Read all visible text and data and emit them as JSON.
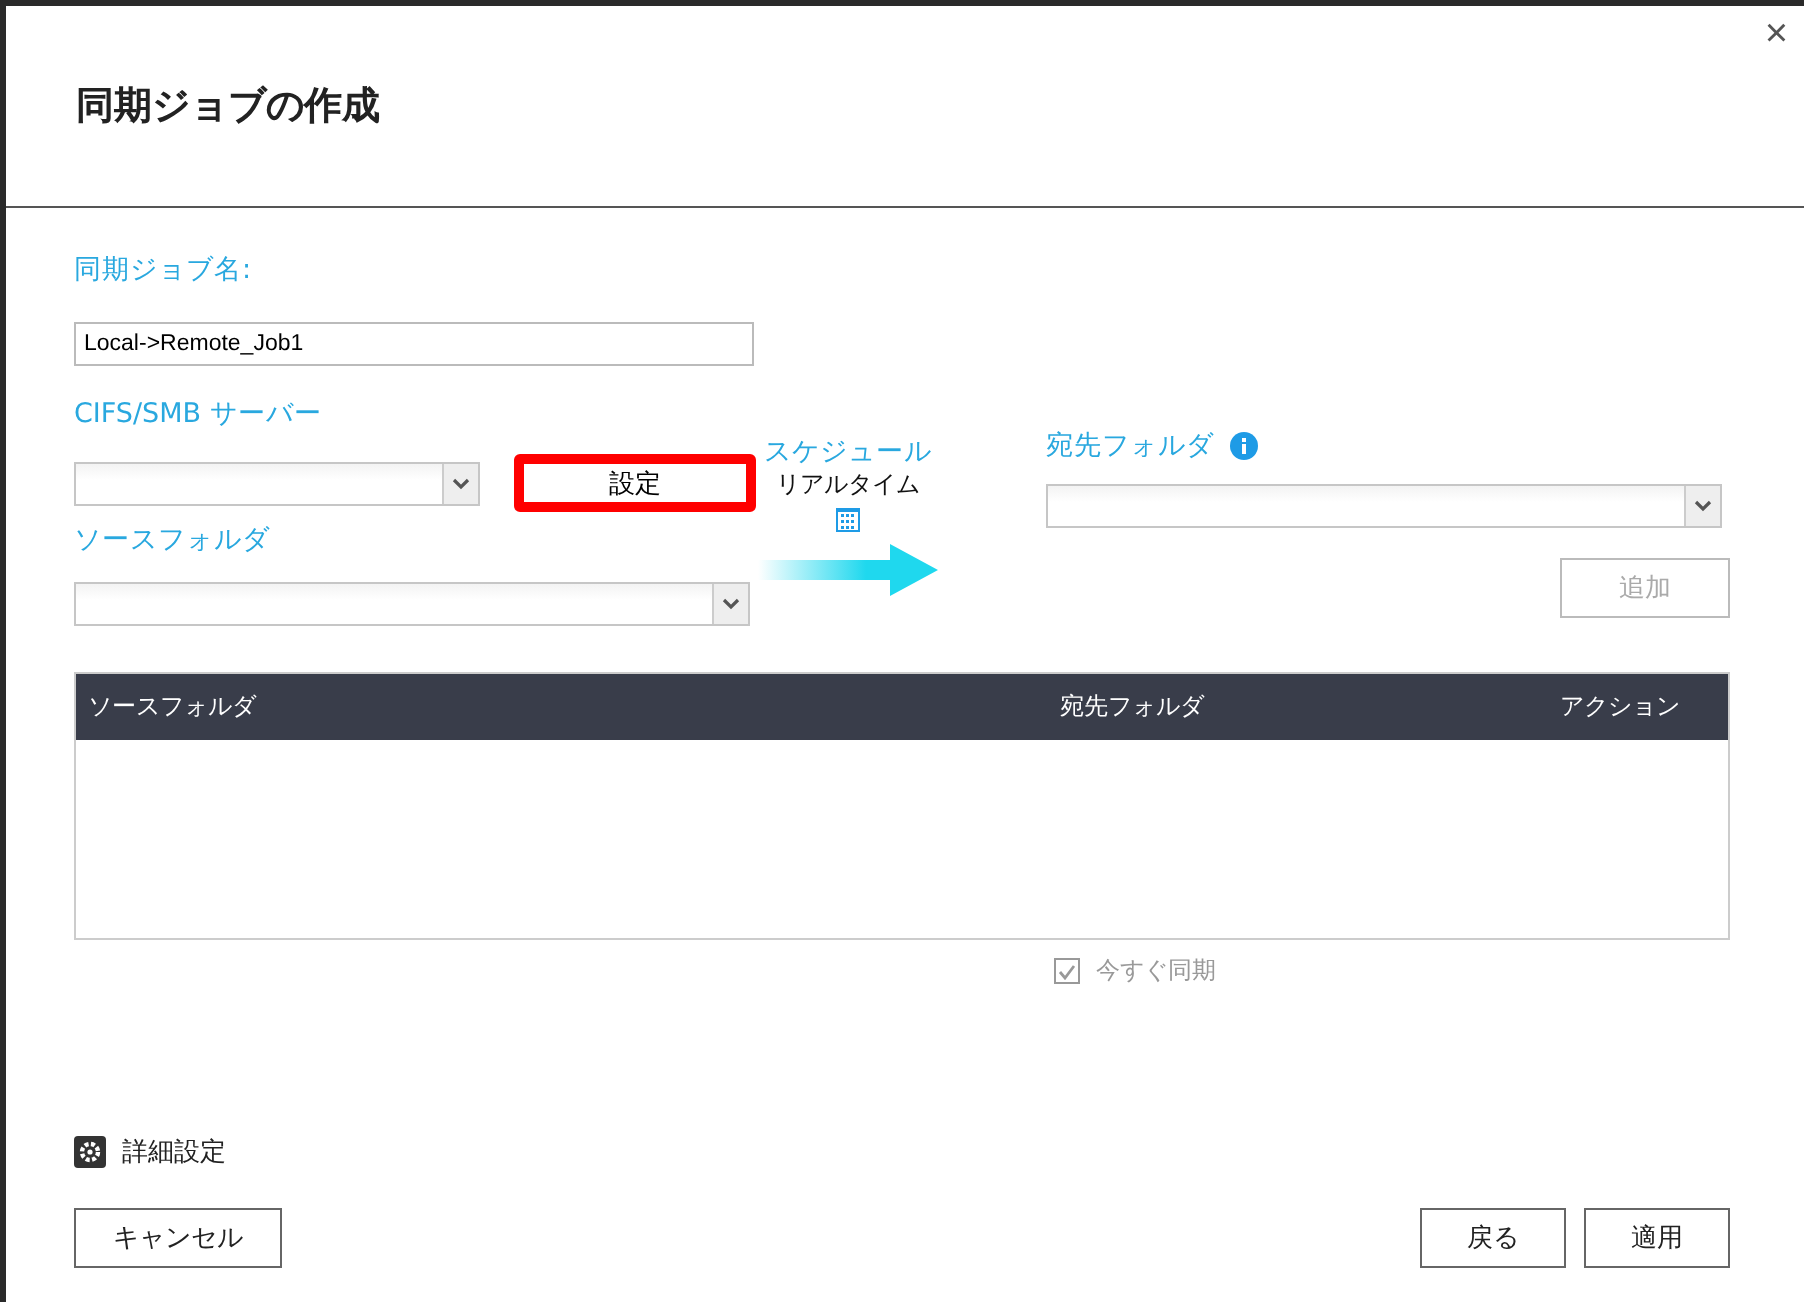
{
  "dialog": {
    "title": "同期ジョブの作成",
    "close": "×"
  },
  "job_name": {
    "label": "同期ジョブ名:",
    "value": "Local->Remote_Job1"
  },
  "server": {
    "label": "CIFS/SMB サーバー",
    "settings_button": {
      "label": "設定",
      "highlighted": true
    }
  },
  "source": {
    "label": "ソースフォルダ"
  },
  "schedule": {
    "label": "スケジュール",
    "value": "リアルタイム"
  },
  "destination": {
    "label": "宛先フォルダ",
    "add_button": {
      "label": "追加",
      "disabled": true
    }
  },
  "table": {
    "columns": [
      "ソースフォルダ",
      "宛先フォルダ",
      "アクション"
    ]
  },
  "sync_now": {
    "label": "今すぐ同期",
    "checked": true,
    "disabled": true
  },
  "advanced": {
    "label": "詳細設定"
  },
  "buttons": {
    "cancel": "キャンセル",
    "back": "戻る",
    "apply": "適用"
  }
}
